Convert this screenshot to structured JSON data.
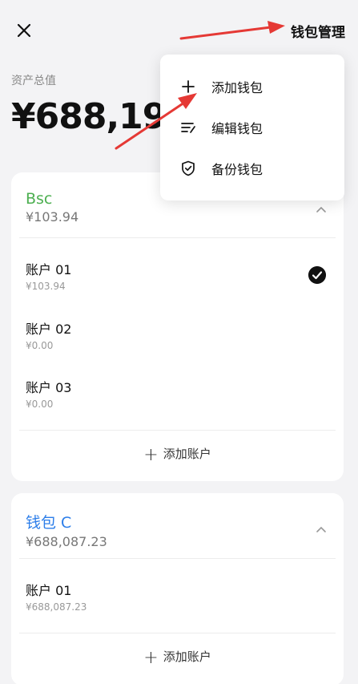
{
  "header": {
    "close_icon": "close-icon",
    "manage_label": "钱包管理"
  },
  "assets": {
    "label": "资产总值",
    "value": "¥688,191"
  },
  "menu": {
    "items": [
      {
        "icon": "plus-icon",
        "label": "添加钱包"
      },
      {
        "icon": "edit-list-icon",
        "label": "编辑钱包"
      },
      {
        "icon": "shield-check-icon",
        "label": "备份钱包"
      }
    ]
  },
  "wallets": [
    {
      "name": "Bsc",
      "total": "¥103.94",
      "accounts": [
        {
          "name": "账户 01",
          "balance": "¥103.94",
          "selected": true
        },
        {
          "name": "账户 02",
          "balance": "¥0.00",
          "selected": false
        },
        {
          "name": "账户 03",
          "balance": "¥0.00",
          "selected": false
        }
      ],
      "add_label": "添加账户"
    },
    {
      "name": "钱包 C",
      "total": "¥688,087.23",
      "accounts": [
        {
          "name": "账户 01",
          "balance": "¥688,087.23",
          "selected": false
        }
      ],
      "add_label": "添加账户"
    }
  ],
  "colors": {
    "accent_green": "#4caf50",
    "accent_blue": "#2b7de9",
    "annotation_red": "#e53935"
  }
}
